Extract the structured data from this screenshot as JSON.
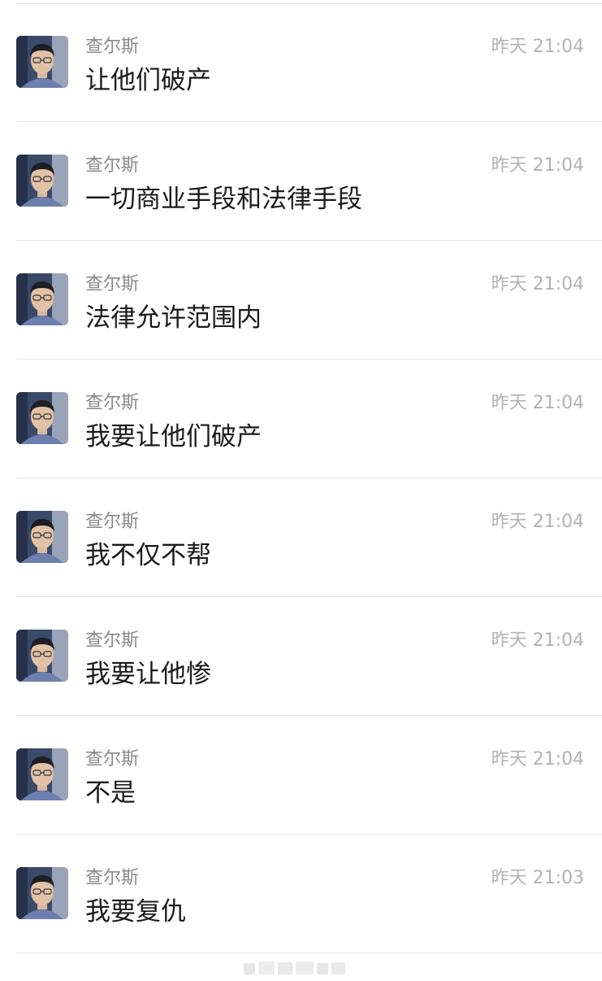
{
  "messages": [
    {
      "sender": "查尔斯",
      "time": "昨天 21:04",
      "text": "让他们破产"
    },
    {
      "sender": "查尔斯",
      "time": "昨天 21:04",
      "text": "一切商业手段和法律手段"
    },
    {
      "sender": "查尔斯",
      "time": "昨天 21:04",
      "text": "法律允许范围内"
    },
    {
      "sender": "查尔斯",
      "time": "昨天 21:04",
      "text": "我要让他们破产"
    },
    {
      "sender": "查尔斯",
      "time": "昨天 21:04",
      "text": "我不仅不帮"
    },
    {
      "sender": "查尔斯",
      "time": "昨天 21:04",
      "text": "我要让他惨"
    },
    {
      "sender": "查尔斯",
      "time": "昨天 21:04",
      "text": "不是"
    },
    {
      "sender": "查尔斯",
      "time": "昨天 21:03",
      "text": "我要复仇"
    }
  ]
}
